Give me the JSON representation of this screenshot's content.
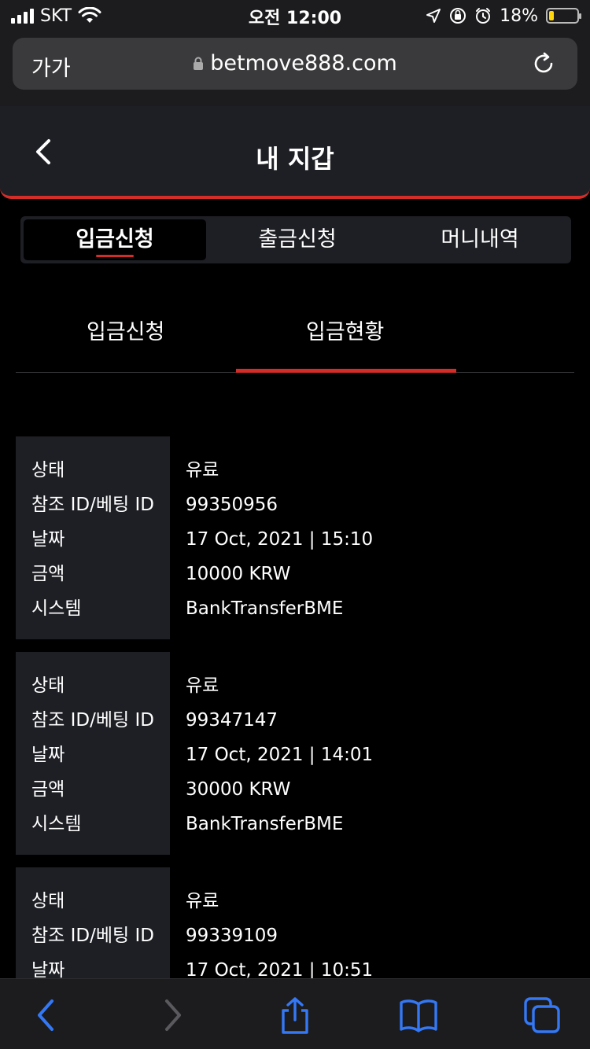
{
  "status_bar": {
    "carrier": "SKT",
    "time": "오전 12:00",
    "battery": "18%",
    "battery_level": 0.18,
    "icons": [
      "signal-icon",
      "wifi-icon",
      "location-icon",
      "orientation-lock-icon",
      "alarm-icon",
      "battery-icon"
    ]
  },
  "browser": {
    "text_size_label": "가가",
    "url": "betmove888.com",
    "icons": [
      "lock-icon",
      "reload-icon"
    ]
  },
  "header": {
    "title": "내 지갑",
    "back_icon": "chevron-left-icon"
  },
  "main_tabs": [
    {
      "label": "입금신청",
      "active": true
    },
    {
      "label": "출금신청",
      "active": false
    },
    {
      "label": "머니내역",
      "active": false
    }
  ],
  "sub_tabs": [
    {
      "label": "입금신청",
      "active": false
    },
    {
      "label": "입금현황",
      "active": true
    }
  ],
  "records": [
    {
      "labels": [
        "상태",
        "참조 ID/베팅 ID",
        "날짜",
        "금액",
        "시스템"
      ],
      "values": [
        "유료",
        "99350956",
        "17 Oct, 2021 | 15:10",
        "10000 KRW",
        "BankTransferBME"
      ]
    },
    {
      "labels": [
        "상태",
        "참조 ID/베팅 ID",
        "날짜",
        "금액",
        "시스템"
      ],
      "values": [
        "유료",
        "99347147",
        "17 Oct, 2021 | 14:01",
        "30000 KRW",
        "BankTransferBME"
      ]
    },
    {
      "labels": [
        "상태",
        "참조 ID/베팅 ID",
        "날짜"
      ],
      "values": [
        "유료",
        "99339109",
        "17 Oct, 2021 | 10:51"
      ]
    }
  ],
  "toolbar": {
    "icons": [
      "back-icon",
      "forward-icon",
      "share-icon",
      "bookmarks-icon",
      "tabs-icon"
    ],
    "accent_color": "#3478f6",
    "disabled_color": "#5a5a5e"
  },
  "colors": {
    "accent": "#d42d28",
    "panel": "#1e1f24",
    "background": "#000000"
  }
}
